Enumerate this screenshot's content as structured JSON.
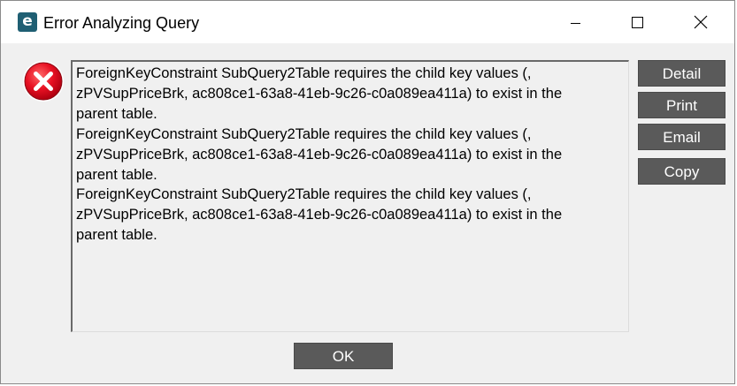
{
  "window": {
    "title": "Error Analyzing Query",
    "app_icon_glyph": "e"
  },
  "titlebar_buttons": {
    "minimize_icon": "minimize-icon",
    "maximize_icon": "maximize-icon",
    "close_icon": "close-icon"
  },
  "error_icon": {
    "name": "error-icon",
    "color": "#e81123"
  },
  "message": {
    "text": "ForeignKeyConstraint SubQuery2Table requires the child key values (,\nzPVSupPriceBrk, ac808ce1-63a8-41eb-9c26-c0a089ea411a) to exist in the\nparent table.\nForeignKeyConstraint SubQuery2Table requires the child key values (,\nzPVSupPriceBrk, ac808ce1-63a8-41eb-9c26-c0a089ea411a) to exist in the\nparent table.\nForeignKeyConstraint SubQuery2Table requires the child key values (,\nzPVSupPriceBrk, ac808ce1-63a8-41eb-9c26-c0a089ea411a) to exist in the\nparent table."
  },
  "buttons": {
    "detail": "Detail",
    "print": "Print",
    "email": "Email",
    "copy": "Copy",
    "ok": "OK"
  },
  "colors": {
    "button_bg": "#5a5a5a",
    "button_text": "#ffffff",
    "app_icon": "#1f5f73"
  }
}
